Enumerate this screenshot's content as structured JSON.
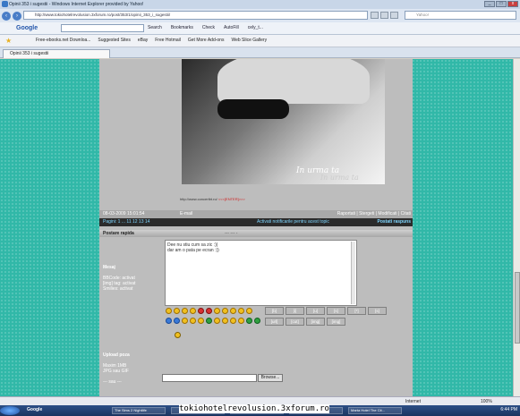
{
  "window": {
    "title": "Opinii 353 i sugestii - Windows Internet Explorer provided by Yahoo!",
    "controls": [
      "_",
      "□",
      "x"
    ]
  },
  "address": {
    "url": "http://www.tokiohotelrevolusion.3xforum.ro/post/353/1/opinii_353_i_sugestii/",
    "search_placeholder": "Yahoo!"
  },
  "toolbar": {
    "google": "Google",
    "search": "Search",
    "bookmarks": "Bookmarks",
    "check": "Check",
    "autofill": "AutoFill",
    "user": "cely_t..."
  },
  "favorites": {
    "items": [
      "Free-ebooks.net Downloa...",
      "Suggested Sites",
      "eBay",
      "Free Hotmail",
      "Get More Add-ons",
      "Web Slice Gallery"
    ]
  },
  "tab": {
    "label": "Opinii 353 i sugestii"
  },
  "post": {
    "photo_caption": "In urma ta",
    "photo_caption2": "In urma ta",
    "signature_url": "http://www.concertbt.ro/",
    "signature_tag": "<<<[ENTER]>>>",
    "date": "08-03-2009 15:01:54",
    "email": "E-mail",
    "actions": "Raportati | Stergeti | Modificati | Citati"
  },
  "pager": {
    "pages": "Pagini: 1 ... 11 12 13 14",
    "notify": "Activati notificarile pentru acest topic",
    "reply": "Postati raspuns"
  },
  "quick_reply": {
    "title": "Postare rapida",
    "center": "--- --- -",
    "message_label": "Mesaj",
    "bbcode": "BBCode: activat",
    "img_tag": "[img] tag: activat",
    "smilies": "Smilies: activat",
    "text_line1": "Dee nu stiu cum sa zic :))",
    "text_line2": "dar am o pata pe ecran :))",
    "format_buttons": [
      "[b]",
      "[i]",
      "[u]",
      "[s]",
      "[*]",
      "[s]",
      "[url]",
      "[cut]",
      "[img]",
      "[img]"
    ]
  },
  "upload": {
    "title": "Upload poza",
    "max": "Maxim 1MB",
    "types": "JPG sau GIF",
    "sep": "--- sau ---",
    "browse": "Browse..."
  },
  "status": {
    "zone": "Internet",
    "zoom": "100%"
  },
  "taskbar": {
    "google": "Google",
    "items": [
      "The Sims 2 Nightlife",
      "",
      "tokiohotelrevolusion...",
      "Cazare O...",
      "Marta Hotel The Cit..."
    ],
    "clock": "6:44 PM"
  },
  "overlay": {
    "watermark": "tokiohotelrevolusion.3xforum.ro"
  }
}
